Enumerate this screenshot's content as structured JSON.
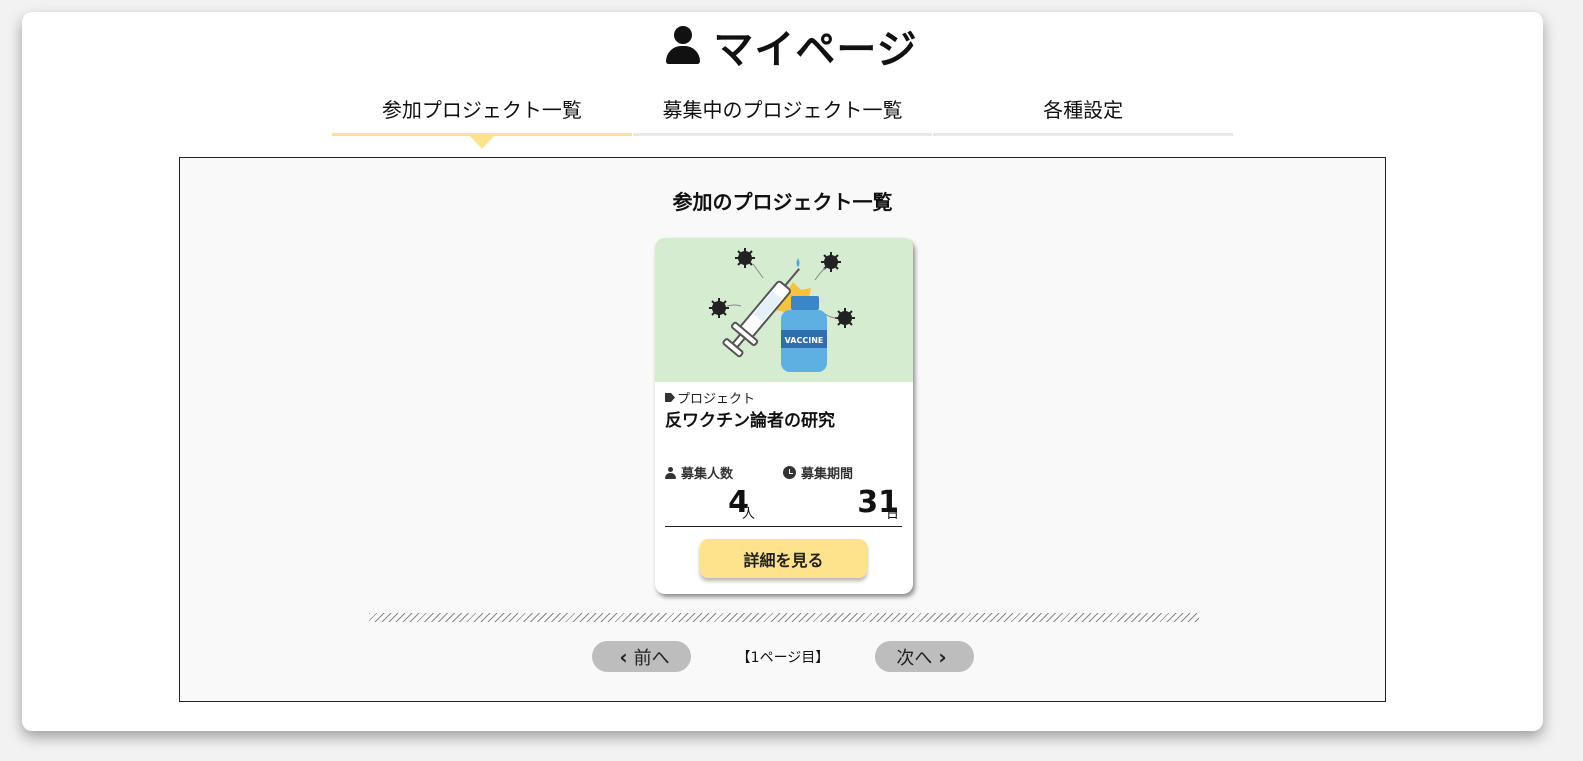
{
  "header": {
    "title": "マイページ"
  },
  "tabs": [
    {
      "label": "参加プロジェクト一覧",
      "active": true
    },
    {
      "label": "募集中のプロジェクト一覧",
      "active": false
    },
    {
      "label": "各種設定",
      "active": false
    }
  ],
  "panel": {
    "title": "参加のプロジェクト一覧"
  },
  "project": {
    "image_text": "VACCINE",
    "category": "プロジェクト",
    "title": "反ワクチン論者の研究",
    "people_label": "募集人数",
    "people_value": "4",
    "people_unit": "人",
    "period_label": "募集期間",
    "period_value": "31",
    "period_unit": "日",
    "detail_button": "詳細を見る"
  },
  "pagination": {
    "prev": "前へ",
    "current": "【1ページ目】",
    "next": "次へ"
  },
  "colors": {
    "accent": "#ffe38c",
    "image_bg": "#d6ecd0",
    "pager": "#bdbdbd"
  }
}
